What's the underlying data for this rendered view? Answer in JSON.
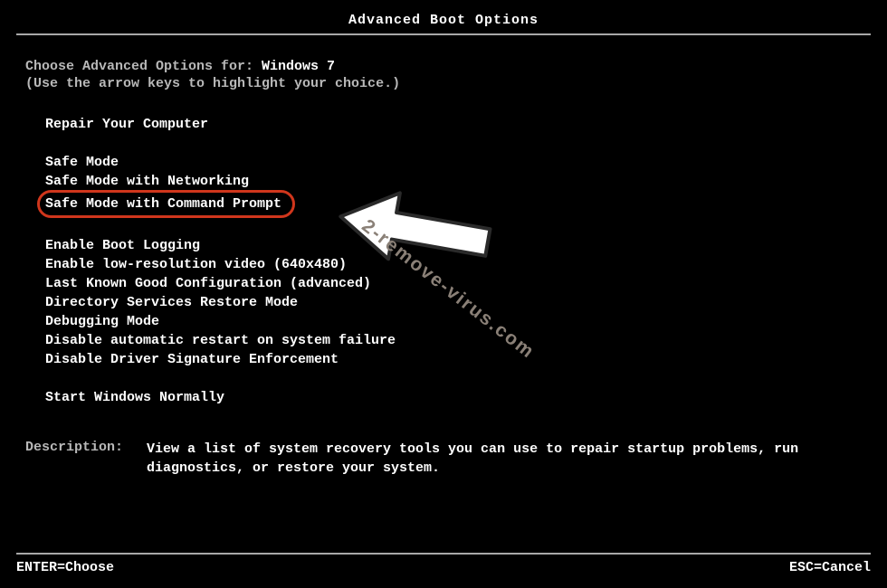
{
  "title": "Advanced Boot Options",
  "intro": {
    "prefix": "Choose Advanced Options for: ",
    "os_name": "Windows 7",
    "hint": "(Use the arrow keys to highlight your choice.)"
  },
  "groups": [
    {
      "items": [
        "Repair Your Computer"
      ]
    },
    {
      "items": [
        "Safe Mode",
        "Safe Mode with Networking",
        "Safe Mode with Command Prompt"
      ],
      "highlighted_index": 2
    },
    {
      "items": [
        "Enable Boot Logging",
        "Enable low-resolution video (640x480)",
        "Last Known Good Configuration (advanced)",
        "Directory Services Restore Mode",
        "Debugging Mode",
        "Disable automatic restart on system failure",
        "Disable Driver Signature Enforcement"
      ]
    },
    {
      "items": [
        "Start Windows Normally"
      ]
    }
  ],
  "description": {
    "label": "Description:",
    "text": "View a list of system recovery tools you can use to repair startup problems, run diagnostics, or restore your system."
  },
  "footer": {
    "enter": "ENTER=Choose",
    "esc": "ESC=Cancel"
  },
  "watermark": "2-remove-virus.com"
}
